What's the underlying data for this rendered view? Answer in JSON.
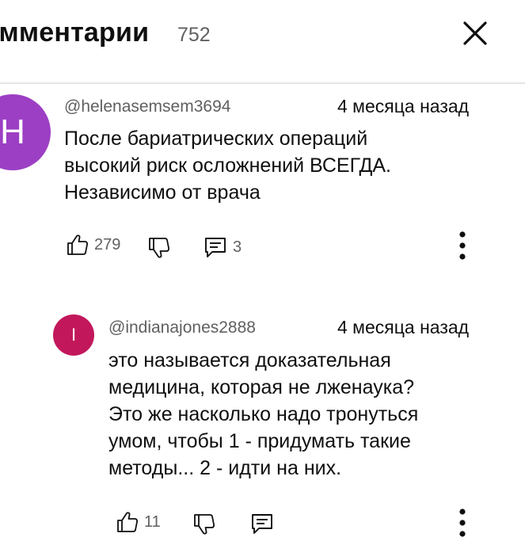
{
  "header": {
    "title": "омментарии",
    "count": "752",
    "close_icon": "close-icon"
  },
  "comments": [
    {
      "avatar_letter": "H",
      "avatar_color": "#9c3fc4",
      "author": "@helenasemsem3694",
      "time": "4 месяца назад",
      "lines": [
        "После бариатрических операций",
        "высокий риск осложнений ВСЕГДА.",
        "Независимо от врача"
      ],
      "likes": "279",
      "replies": "3"
    },
    {
      "avatar_letter": "I",
      "avatar_color": "#c2185b",
      "author": "@indianajones2888",
      "time": "4 месяца назад",
      "lines": [
        "это называется доказательная",
        "медицина, которая не лженаука?",
        "Это же насколько надо тронуться",
        "умом, чтобы 1 - придумать такие",
        "методы... 2 - идти на них."
      ],
      "likes": "11"
    }
  ]
}
